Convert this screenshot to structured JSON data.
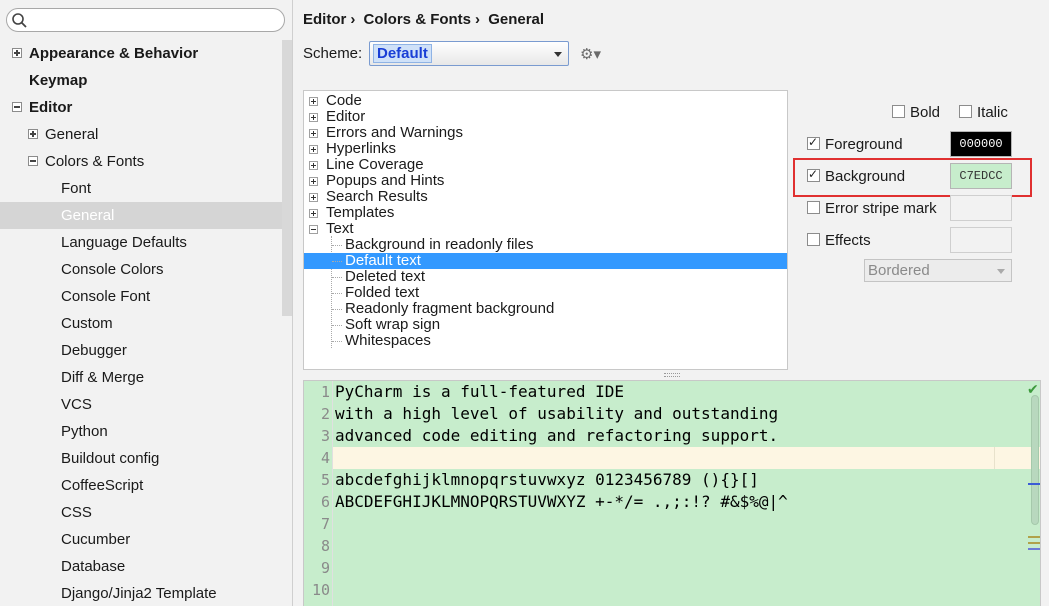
{
  "sidebar": {
    "search": {
      "placeholder": "",
      "value": ""
    },
    "items": [
      {
        "label": "Appearance & Behavior",
        "level": 0,
        "expander": "plus",
        "bold": true
      },
      {
        "label": "Keymap",
        "level": 0,
        "expander": "none",
        "bold": true
      },
      {
        "label": "Editor",
        "level": 0,
        "expander": "minus",
        "bold": true
      },
      {
        "label": "General",
        "level": 1,
        "expander": "plus"
      },
      {
        "label": "Colors & Fonts",
        "level": 1,
        "expander": "minus"
      },
      {
        "label": "Font",
        "level": 2
      },
      {
        "label": "General",
        "level": 2,
        "selected": true
      },
      {
        "label": "Language Defaults",
        "level": 2
      },
      {
        "label": "Console Colors",
        "level": 2
      },
      {
        "label": "Console Font",
        "level": 2
      },
      {
        "label": "Custom",
        "level": 2
      },
      {
        "label": "Debugger",
        "level": 2
      },
      {
        "label": "Diff & Merge",
        "level": 2
      },
      {
        "label": "VCS",
        "level": 2
      },
      {
        "label": "Python",
        "level": 2
      },
      {
        "label": "Buildout config",
        "level": 2
      },
      {
        "label": "CoffeeScript",
        "level": 2
      },
      {
        "label": "CSS",
        "level": 2
      },
      {
        "label": "Cucumber",
        "level": 2
      },
      {
        "label": "Database",
        "level": 2
      },
      {
        "label": "Django/Jinja2 Template",
        "level": 2
      }
    ]
  },
  "breadcrumb": [
    "Editor",
    "›",
    "Colors & Fonts",
    "›",
    "General"
  ],
  "scheme": {
    "label": "Scheme:",
    "value": "Default"
  },
  "attributes": [
    {
      "label": "Code",
      "expander": "plus",
      "level": 0
    },
    {
      "label": "Editor",
      "expander": "plus",
      "level": 0
    },
    {
      "label": "Errors and Warnings",
      "expander": "plus",
      "level": 0
    },
    {
      "label": "Hyperlinks",
      "expander": "plus",
      "level": 0
    },
    {
      "label": "Line Coverage",
      "expander": "plus",
      "level": 0
    },
    {
      "label": "Popups and Hints",
      "expander": "plus",
      "level": 0
    },
    {
      "label": "Search Results",
      "expander": "plus",
      "level": 0
    },
    {
      "label": "Templates",
      "expander": "plus",
      "level": 0
    },
    {
      "label": "Text",
      "expander": "minus",
      "level": 0
    },
    {
      "label": "Background in readonly files",
      "level": 1
    },
    {
      "label": "Default text",
      "level": 1,
      "selected": true
    },
    {
      "label": "Deleted text",
      "level": 1
    },
    {
      "label": "Folded text",
      "level": 1
    },
    {
      "label": "Readonly fragment background",
      "level": 1
    },
    {
      "label": "Soft wrap sign",
      "level": 1
    },
    {
      "label": "Whitespaces",
      "level": 1
    }
  ],
  "options": {
    "bold": {
      "label": "Bold",
      "checked": false
    },
    "italic": {
      "label": "Italic",
      "checked": false
    },
    "foreground": {
      "label": "Foreground",
      "checked": true,
      "color_text": "000000",
      "color": "#000000",
      "text_color": "#ffffff"
    },
    "background": {
      "label": "Background",
      "checked": true,
      "color_text": "C7EDCC",
      "color": "#c7edcc",
      "text_color": "#333333"
    },
    "error_stripe": {
      "label": "Error stripe mark",
      "checked": false
    },
    "effects": {
      "label": "Effects",
      "checked": false,
      "style": "Bordered"
    }
  },
  "preview": {
    "line_numbers": [
      "1",
      "2",
      "3",
      "4",
      "5",
      "6",
      "7",
      "8",
      "9",
      "10"
    ],
    "lines": [
      "PyCharm is a full-featured IDE",
      "with a high level of usability and outstanding",
      "advanced code editing and refactoring support.",
      "",
      "abcdefghijklmnopqrstuvwxyz 0123456789 (){}[]",
      "ABCDEFGHIJKLMNOPQRSTUVWXYZ +-*/= .,;:!? #&$%@|^",
      "",
      "",
      "",
      ""
    ],
    "background": "#c7edcc",
    "caret_line_background": "#fdf6e3"
  }
}
